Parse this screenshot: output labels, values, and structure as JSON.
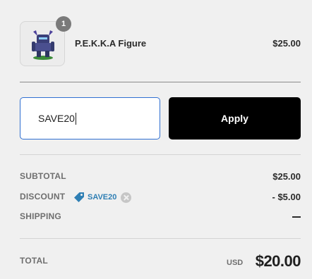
{
  "product": {
    "quantity": "1",
    "name": "P.E.K.K.A Figure",
    "price": "$25.00",
    "thumbnail_icon": "figure-thumbnail-icon"
  },
  "discount_form": {
    "input_value": "SAVE20",
    "apply_label": "Apply",
    "focus_color": "#2f6fd1"
  },
  "summary": {
    "subtotal_label": "SUBTOTAL",
    "subtotal_value": "$25.00",
    "discount_label": "DISCOUNT",
    "discount_code": "SAVE20",
    "discount_value": "- $5.00",
    "code_color": "#2f7fb4",
    "shipping_label": "SHIPPING",
    "total_label": "TOTAL",
    "currency": "USD",
    "total_value": "$20.00"
  }
}
